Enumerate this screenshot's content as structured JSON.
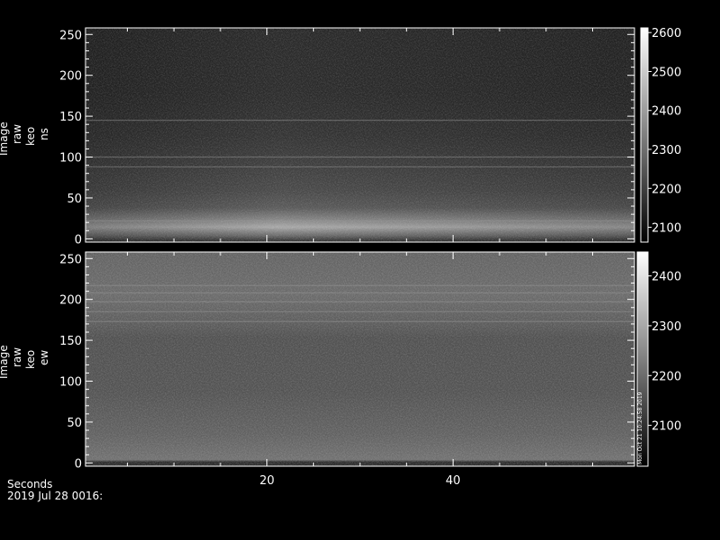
{
  "chart_data": [
    {
      "type": "heatmap",
      "panel": "ns",
      "ylabel_lines": [
        "Image",
        "raw",
        "keo",
        "ns"
      ],
      "yticks": [
        0,
        50,
        100,
        150,
        200,
        250
      ],
      "ylim": [
        -4,
        258
      ],
      "colorbar": {
        "ticks": [
          2100,
          2200,
          2300,
          2400,
          2500,
          2600
        ],
        "range": [
          2062,
          2612
        ]
      },
      "bright_band_rows": [
        22,
        88,
        100,
        145
      ],
      "background": "dark-gray noise with brighter band near row 22"
    },
    {
      "type": "heatmap",
      "panel": "ew",
      "ylabel_lines": [
        "Image",
        "raw",
        "keo",
        "ew"
      ],
      "yticks": [
        0,
        50,
        100,
        150,
        200,
        250
      ],
      "ylim": [
        -4,
        258
      ],
      "colorbar": {
        "ticks": [
          2100,
          2200,
          2300,
          2400
        ],
        "range": [
          2018,
          2448
        ]
      },
      "bright_band_rows": [
        173,
        185,
        197,
        208,
        217
      ],
      "colorbar_note": "Mon Oct 21 10:24:58 2019",
      "background": "mid-gray noise, dark strip near row 0"
    }
  ],
  "xaxis": {
    "label": "Seconds",
    "ticks": [
      20,
      40
    ],
    "xlim": [
      0.5,
      59.5
    ]
  },
  "date_label": "2019 Jul 28 0016:",
  "colors": {
    "background": "#000000",
    "axes": "#ffffff"
  }
}
